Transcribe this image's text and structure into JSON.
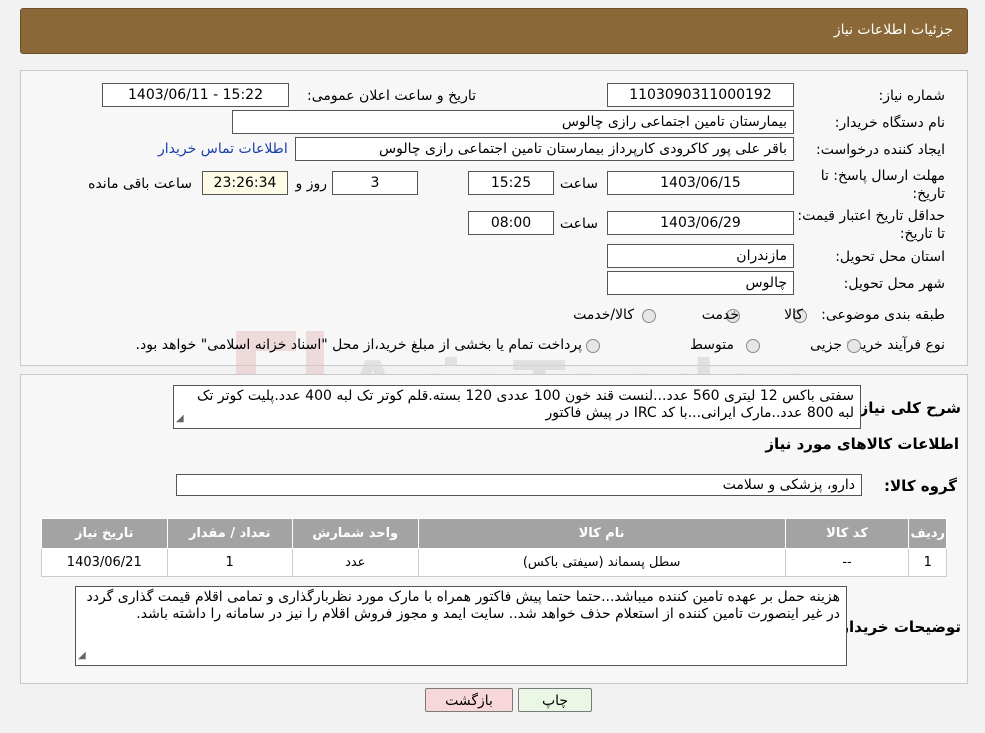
{
  "header": {
    "title": "جزئیات اطلاعات نیاز"
  },
  "watermark": {
    "text": "AriaTender.neT"
  },
  "form": {
    "need_number": {
      "label": "شماره نیاز:",
      "value": "1103090311000192"
    },
    "announce_datetime": {
      "label": "تاریخ و ساعت اعلان عمومی:",
      "value": "1403/06/11 - 15:22"
    },
    "buyer_org": {
      "label": "نام دستگاه خریدار:",
      "value": "بیمارستان تامین اجتماعی رازی چالوس"
    },
    "requester": {
      "label": "ایجاد کننده درخواست:",
      "value": "باقر علی پور کاکرودی کارپرداز بیمارستان تامین اجتماعی رازی چالوس",
      "contact_link": "اطلاعات تماس خریدار"
    },
    "deadline": {
      "label": "مهلت ارسال پاسخ: تا تاریخ:",
      "date": "1403/06/15",
      "time_label": "ساعت",
      "time": "15:25",
      "days": "3",
      "days_label": "روز و",
      "remaining": "23:26:34",
      "remaining_label": "ساعت باقی مانده"
    },
    "validity": {
      "label": "حداقل تاریخ اعتبار قیمت: تا تاریخ:",
      "date": "1403/06/29",
      "time_label": "ساعت",
      "time": "08:00"
    },
    "province": {
      "label": "استان محل تحویل:",
      "value": "مازندران"
    },
    "city": {
      "label": "شهر محل تحویل:",
      "value": "چالوس"
    },
    "category": {
      "label": "طبقه بندی موضوعی:",
      "options": [
        "کالا",
        "خدمت",
        "کالا/خدمت"
      ]
    },
    "process": {
      "label": "نوع فرآیند خرید :",
      "options": [
        "جزیی",
        "متوسط"
      ],
      "note": "پرداخت تمام یا بخشی از مبلغ خرید،از محل \"اسناد خزانه اسلامی\" خواهد بود."
    }
  },
  "details": {
    "summary_label": "شرح کلی نیاز:",
    "summary": "سفتی باکس 12 لیتری 560 عدد...لنست قند خون 100 عددی 120 بسته.قلم کوتر تک لبه 400 عدد.پلیت کوتر تک لبه 800 عدد..مارک ایرانی...با کد IRC  در پیش فاکتور",
    "items_title": "اطلاعات کالاهای مورد نیاز",
    "group_label": "گروه کالا:",
    "group_value": "دارو، پزشکی و سلامت",
    "table": {
      "headers": [
        "ردیف",
        "کد کالا",
        "نام کالا",
        "واحد شمارش",
        "تعداد / مقدار",
        "تاریخ نیاز"
      ],
      "rows": [
        [
          "1",
          "--",
          "سطل پسماند (سیفتی باکس)",
          "عدد",
          "1",
          "1403/06/21"
        ]
      ]
    },
    "buyer_notes_label": "توضیحات خریدار:",
    "buyer_notes": "هزینه حمل بر عهده تامین کننده میباشد...حتما حتما پیش فاکتور  همراه با مارک مورد نظربارگذاری و تمامی اقلام قیمت گذاری گردد در غیر اینصورت تامین کننده از استعلام حذف خواهد شد.. سایت ایمد و مجوز فروش اقلام را نیز در سامانه را داشته باشد."
  },
  "buttons": {
    "print": "چاپ",
    "back": "بازگشت"
  },
  "colors": {
    "header": "#8b6838",
    "back_button": "#f8d7da",
    "print_button": "#eaf7e4"
  }
}
